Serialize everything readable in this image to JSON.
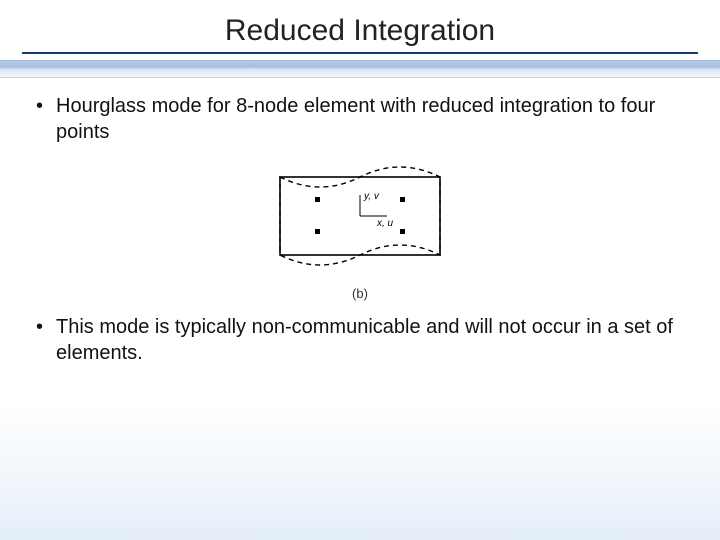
{
  "title": "Reduced Integration",
  "bullets": [
    "Hourglass mode for 8-node element with reduced integration to four points",
    "This mode is typically non-communicable and will not occur in a set of elements."
  ],
  "figure": {
    "axis_y": "y, v",
    "axis_x": "x, u",
    "caption": "(b)"
  }
}
